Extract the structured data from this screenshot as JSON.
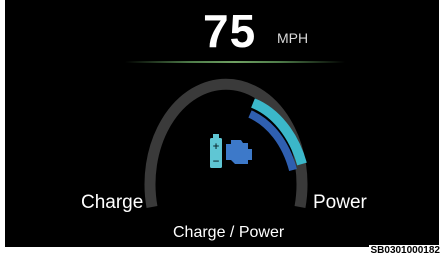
{
  "speed": {
    "value": "75",
    "unit": "MPH"
  },
  "gauge": {
    "left_label": "Charge",
    "right_label": "Power",
    "mode_label": "Charge / Power",
    "center_icon": "battery-engine-icon"
  },
  "colors": {
    "background": "#000000",
    "track": "#3a3a3a",
    "power_outer": "#3bb7c9",
    "power_inner": "#2f5fb0",
    "icon_battery": "#5fc6d4",
    "icon_engine": "#3d79c9",
    "divider": "#6fa062"
  },
  "reference_code": "SB0301000182"
}
